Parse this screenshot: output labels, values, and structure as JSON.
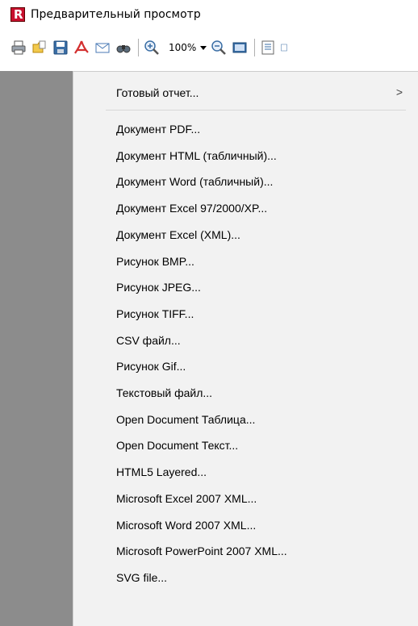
{
  "window": {
    "title": "Предварительный просмотр",
    "logo_letter": "R"
  },
  "toolbar": {
    "zoom_value": "100%",
    "icons": [
      "print-icon",
      "open-icon",
      "save-icon",
      "pdf-icon",
      "email-icon",
      "find-icon",
      "zoom-in-icon",
      "zoom-out-icon",
      "page-view-icon",
      "page-setup-icon",
      "outline-icon"
    ]
  },
  "export_menu": {
    "submenu": {
      "label": "Готовый отчет...",
      "arrow": ">"
    },
    "items": [
      "Документ PDF...",
      "Документ HTML (табличный)...",
      "Документ Word (табличный)...",
      "Документ Excel 97/2000/XP...",
      "Документ Excel (XML)...",
      "Рисунок BMP...",
      "Рисунок JPEG...",
      "Рисунок TIFF...",
      "CSV файл...",
      "Рисунок Gif...",
      "Текстовый файл...",
      "Open Document Таблица...",
      "Open Document Текст...",
      "HTML5 Layered...",
      "Microsoft Excel 2007 XML...",
      "Microsoft Word 2007 XML...",
      "Microsoft PowerPoint 2007 XML...",
      "SVG file..."
    ]
  },
  "colors": {
    "menu_bg": "#f2f2f2",
    "left_pane": "#8c8c8c",
    "logo_red": "#c8102e"
  }
}
